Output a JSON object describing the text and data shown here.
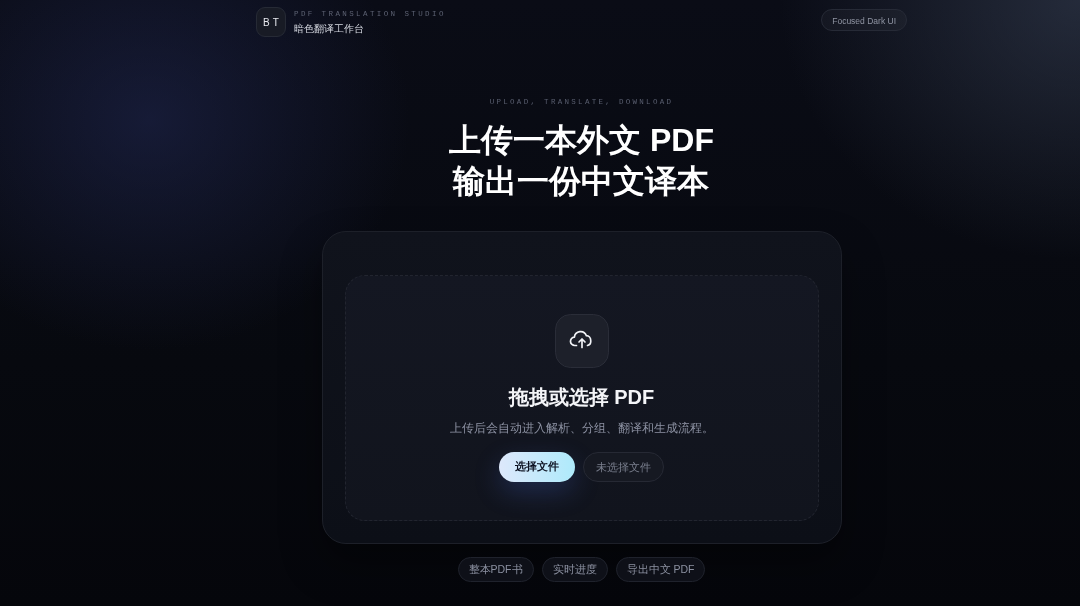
{
  "header": {
    "logo": "BT",
    "eyebrow": "PDF TRANSLATION STUDIO",
    "title": "暗色翻译工作台",
    "badge": "Focused Dark UI"
  },
  "hero": {
    "eyebrow": "UPLOAD, TRANSLATE, DOWNLOAD",
    "title_lines": [
      "上传一本外文 PDF",
      "输出一份中文译本"
    ]
  },
  "upload": {
    "heading": "拖拽或选择 PDF",
    "description": "上传后会自动进入解析、分组、翻译和生成流程。",
    "choose_button": "选择文件",
    "file_status": "未选择文件"
  },
  "features": [
    "整本PDF书",
    "实时进度",
    "导出中文 PDF"
  ]
}
